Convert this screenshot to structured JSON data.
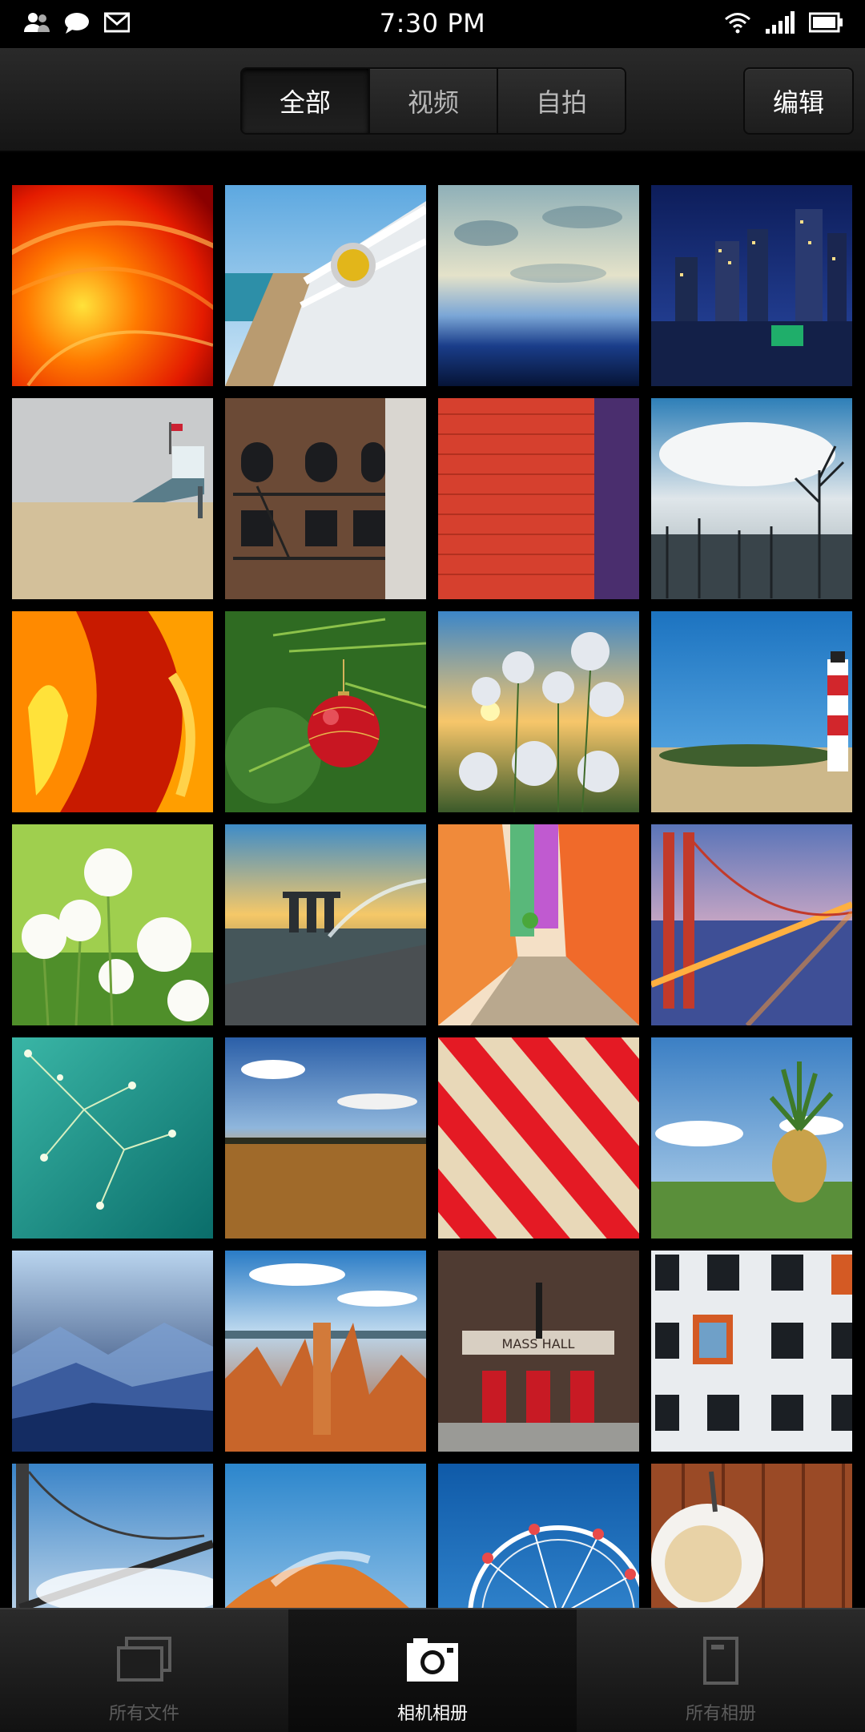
{
  "status_bar": {
    "time": "7:30 PM",
    "left_icons": [
      "contacts-icon",
      "chat-bubble-icon",
      "mail-icon"
    ],
    "right_icons": [
      "wifi-icon",
      "signal-icon",
      "battery-icon"
    ]
  },
  "toolbar": {
    "tabs": [
      {
        "label": "全部",
        "active": true
      },
      {
        "label": "视频",
        "active": false
      },
      {
        "label": "自拍",
        "active": false
      }
    ],
    "edit_label": "编辑"
  },
  "photos": [
    {
      "name": "abstract-red-swirl"
    },
    {
      "name": "pier-railing"
    },
    {
      "name": "earth-horizon"
    },
    {
      "name": "city-night"
    },
    {
      "name": "beach-lifeguard-tower"
    },
    {
      "name": "brick-building"
    },
    {
      "name": "red-purple-wall"
    },
    {
      "name": "dead-trees-sky"
    },
    {
      "name": "orange-abstract"
    },
    {
      "name": "christmas-ornament"
    },
    {
      "name": "cotton-grass-sunset"
    },
    {
      "name": "lighthouse"
    },
    {
      "name": "dandelions"
    },
    {
      "name": "singapore-bay"
    },
    {
      "name": "colorful-alley"
    },
    {
      "name": "golden-gate-night"
    },
    {
      "name": "dill-flower"
    },
    {
      "name": "field-landscape"
    },
    {
      "name": "striped-planks"
    },
    {
      "name": "pineapple-field"
    },
    {
      "name": "blue-mountains"
    },
    {
      "name": "canyon-hoodoos"
    },
    {
      "name": "music-hall"
    },
    {
      "name": "white-building-windows"
    },
    {
      "name": "bridge-fog"
    },
    {
      "name": "sand-dune"
    },
    {
      "name": "ferris-wheel"
    },
    {
      "name": "coffee-cup-wood"
    }
  ],
  "bottom_nav": [
    {
      "label": "所有文件",
      "icon": "files-stack-icon",
      "active": false
    },
    {
      "label": "相机相册",
      "icon": "camera-icon",
      "active": true
    },
    {
      "label": "所有相册",
      "icon": "album-book-icon",
      "active": false
    }
  ],
  "colors": {
    "background": "#000000",
    "toolbar": "#1f1f1f",
    "active_text": "#ffffff",
    "inactive_text": "#5c5c5c"
  }
}
